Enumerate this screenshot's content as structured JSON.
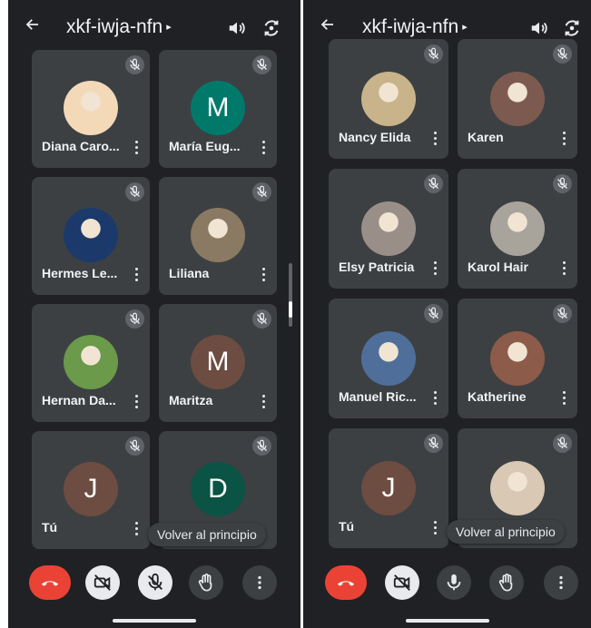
{
  "left": {
    "title": "xkf-iwja-nfn",
    "jump_label": "Volver al principio",
    "tiles": [
      {
        "name": "Diana Caro...",
        "avatar": "photo",
        "initial": "",
        "color": "#f3d9b8"
      },
      {
        "name": "María Eug...",
        "avatar": "letter",
        "initial": "M",
        "color": "#00796b"
      },
      {
        "name": "Hermes Le...",
        "avatar": "photo",
        "initial": "",
        "color": "#1b3a6b"
      },
      {
        "name": "Liliana",
        "avatar": "photo",
        "initial": "",
        "color": "#8a7a63"
      },
      {
        "name": "Hernan Da...",
        "avatar": "photo",
        "initial": "",
        "color": "#6a9a4a"
      },
      {
        "name": "Maritza",
        "avatar": "letter",
        "initial": "M",
        "color": "#6d4c41"
      },
      {
        "name": "Tú",
        "avatar": "letter",
        "initial": "J",
        "color": "#6d4c41"
      },
      {
        "name": "",
        "avatar": "letter",
        "initial": "D",
        "color": "#0b5345"
      }
    ]
  },
  "right": {
    "title": "xkf-iwja-nfn",
    "jump_label": "Volver al principio",
    "tiles": [
      {
        "name": "Nancy Elida",
        "avatar": "photo",
        "initial": "",
        "color": "#c9b38a"
      },
      {
        "name": "Karen",
        "avatar": "photo",
        "initial": "",
        "color": "#7d5a4f"
      },
      {
        "name": "Elsy Patricia",
        "avatar": "photo",
        "initial": "",
        "color": "#9a8f88"
      },
      {
        "name": "Karol Hair",
        "avatar": "photo",
        "initial": "",
        "color": "#a9a49b"
      },
      {
        "name": "Manuel Ric...",
        "avatar": "photo",
        "initial": "",
        "color": "#4f6f9a"
      },
      {
        "name": "Katherine",
        "avatar": "photo",
        "initial": "",
        "color": "#8c5b4a"
      },
      {
        "name": "Tú",
        "avatar": "letter",
        "initial": "J",
        "color": "#6d4c41"
      },
      {
        "name": "",
        "avatar": "photo",
        "initial": "",
        "color": "#d8c8b4"
      }
    ]
  },
  "icons": {
    "back": "arrow-back-icon",
    "speaker": "speaker-icon",
    "switch_camera": "switch-camera-icon",
    "mic_off": "mic-off-icon",
    "more": "more-vert-icon",
    "end_call": "end-call-icon",
    "camera_off": "camera-off-icon",
    "mic": "mic-icon",
    "raise_hand": "raise-hand-icon"
  },
  "colors": {
    "background": "#202124",
    "tile": "#3c4043",
    "end_call": "#ea4335"
  }
}
